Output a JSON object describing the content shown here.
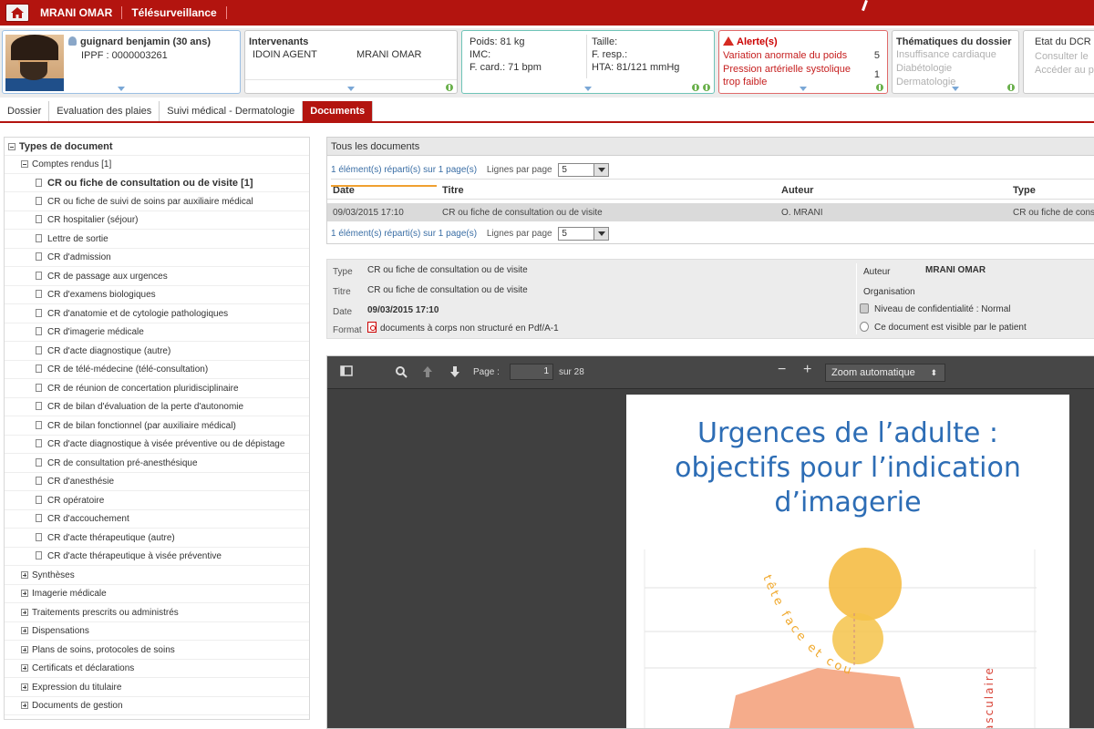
{
  "topbar": {
    "user": "MRANI OMAR",
    "app": "Télésurveillance"
  },
  "patient": {
    "name": "guignard benjamin (30 ans)",
    "ippf": "IPPF : 0000003261"
  },
  "intervenants": {
    "title": "Intervenants",
    "agent": "IDOIN AGENT",
    "doctor": "MRANI OMAR"
  },
  "vitals": {
    "poids": "Poids: 81 kg",
    "imc": "IMC:",
    "fcard": "F. card.: 71 bpm",
    "taille": "Taille:",
    "fresp": "F. resp.:",
    "hta": "HTA: 81/121 mmHg"
  },
  "alerts": {
    "title": "Alerte(s)",
    "items": [
      {
        "label": "Variation anormale du poids",
        "count": "5"
      },
      {
        "label": "Pression artérielle systolique",
        "count": "1"
      },
      {
        "label": "trop faible",
        "count": ""
      }
    ]
  },
  "thematiques": {
    "title": "Thématiques du dossier",
    "items": [
      "Insuffisance cardiaque",
      "Diabétologie",
      "Dermatologie"
    ]
  },
  "etat": {
    "title": "Etat du DCR",
    "items": [
      "Consulter le",
      "Accéder au p"
    ]
  },
  "tabs": [
    "Dossier",
    "Evaluation des plaies",
    "Suivi médical - Dermatologie",
    "Documents"
  ],
  "tree": {
    "root": "Types de document",
    "comptes_rendus": "Comptes rendus [1]",
    "cr_items": [
      "CR ou fiche de consultation ou de visite [1]",
      "CR ou fiche de suivi de soins par auxiliaire médical",
      "CR hospitalier (séjour)",
      "Lettre de sortie",
      "CR d'admission",
      "CR de passage aux urgences",
      "CR d'examens biologiques",
      "CR d'anatomie et de cytologie pathologiques",
      "CR d'imagerie médicale",
      "CR d'acte diagnostique (autre)",
      "CR de télé-médecine (télé-consultation)",
      "CR de réunion de concertation pluridisciplinaire",
      "CR de bilan d'évaluation de la perte d'autonomie",
      "CR de bilan fonctionnel (par auxiliaire médical)",
      "CR d'acte diagnostique à visée préventive ou de dépistage",
      "CR de consultation pré-anesthésique",
      "CR d'anesthésie",
      "CR opératoire",
      "CR d'accouchement",
      "CR d'acte thérapeutique (autre)",
      "CR d'acte thérapeutique à visée préventive"
    ],
    "groups": [
      "Synthèses",
      "Imagerie médicale",
      "Traitements prescrits ou administrés",
      "Dispensations",
      "Plans de soins, protocoles de soins",
      "Certificats et déclarations",
      "Expression du titulaire",
      "Documents de gestion"
    ]
  },
  "docs": {
    "header": "Tous les documents",
    "pager_info": "1 élément(s) réparti(s) sur 1 page(s)",
    "lines_label": "Lignes par page",
    "lines_value": "5",
    "columns": {
      "date": "Date",
      "title": "Titre",
      "author": "Auteur",
      "type": "Type"
    },
    "row": {
      "date": "09/03/2015 17:10",
      "title": "CR ou fiche de consultation ou de visite",
      "author": "O. MRANI",
      "type": "CR ou fiche de cons"
    }
  },
  "details": {
    "type_k": "Type",
    "type_v": "CR ou fiche de consultation ou de visite",
    "titre_k": "Titre",
    "titre_v": "CR ou fiche de consultation ou de visite",
    "date_k": "Date",
    "date_v": "09/03/2015 17:10",
    "format_k": "Format",
    "format_v": "documents à corps non structuré en Pdf/A-1",
    "auteur_k": "Auteur",
    "auteur_v": "MRANI OMAR",
    "org_k": "Organisation",
    "conf": "Niveau de confidentialité : Normal",
    "visible": "Ce document est visible par le patient"
  },
  "viewer": {
    "page_label": "Page :",
    "page_value": "1",
    "page_total": "sur 28",
    "zoom": "Zoom automatique",
    "pdf_title_1": "Urgences de l’adulte :",
    "pdf_title_2": "objectifs pour l’indication",
    "pdf_title_3": "d’imagerie",
    "pdf_curved_1": "tête face et cou",
    "pdf_curved_2": "asculaire"
  },
  "colors": {
    "brand": "#b3140f",
    "link": "#3a6ea5",
    "pdf_title": "#2d6db5",
    "orange": "#f5b93a",
    "salmon": "#f4a37e"
  }
}
